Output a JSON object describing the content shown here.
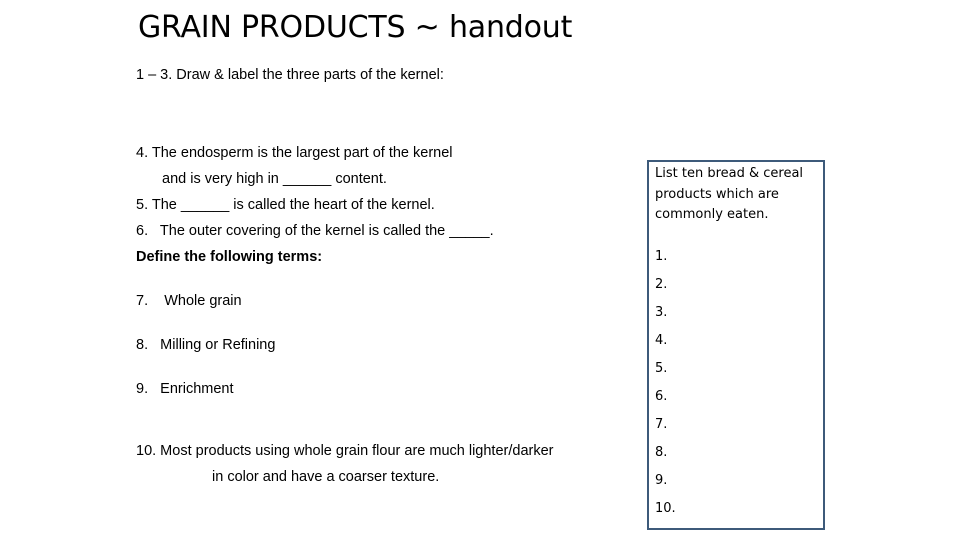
{
  "slide": {
    "title": "GRAIN PRODUCTS ~ handout",
    "background_color": "#ffffff",
    "text_color": "#000000"
  },
  "body": {
    "question_1_3": "1 – 3. Draw & label the three parts of the kernel:",
    "question_4_line1": "4. The endosperm is the largest part of the kernel",
    "question_4_line2": "and is very high in ______ content.",
    "question_5": "5. The ______ is called the heart of the kernel.",
    "question_6": "6.   The outer covering of the kernel is called the _____.",
    "define_heading": "Define the following terms:",
    "question_7": "7.    Whole grain",
    "question_8": "8.   Milling or Refining",
    "question_9": "9.   Enrichment",
    "question_10_line1": "10. Most products using whole grain flour are much lighter/darker",
    "question_10_line2": "in color and have a coarser texture."
  },
  "listbox": {
    "border_color": "#3d5a7a",
    "prompt": "List ten bread & cereal products which are commonly eaten.",
    "items": [
      "1.",
      "2.",
      "3.",
      "4.",
      "5.",
      "6.",
      "7.",
      "8.",
      "9.",
      "10."
    ]
  }
}
